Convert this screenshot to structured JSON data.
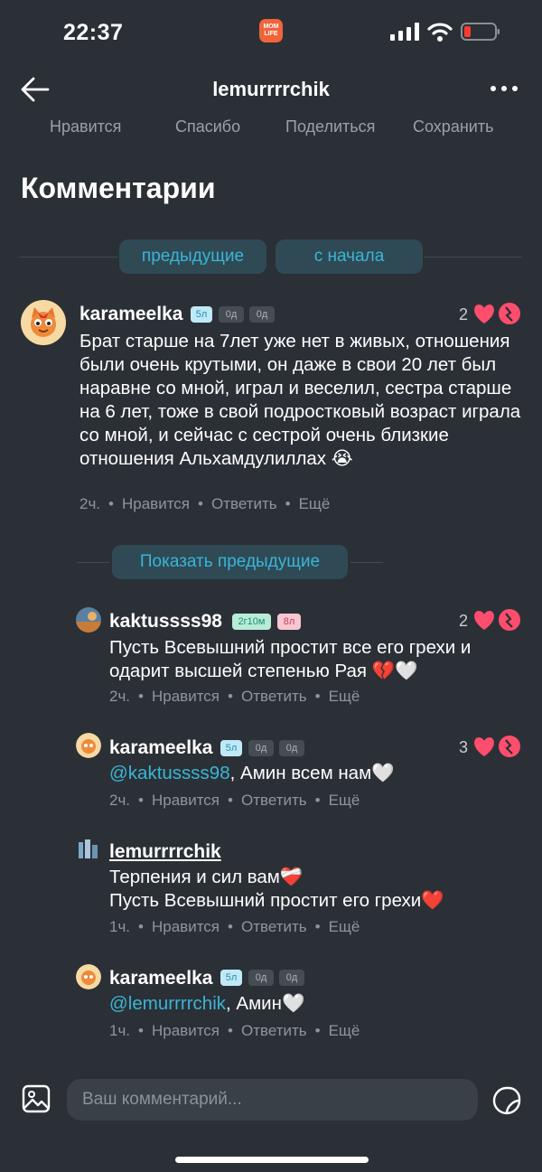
{
  "status": {
    "time": "22:37",
    "app_badge": "MOM LIFE"
  },
  "header": {
    "title": "lemurrrrchik"
  },
  "actions": [
    "Нравится",
    "Спасибо",
    "Поделиться",
    "Сохранить"
  ],
  "section_title": "Комментарии",
  "pager": {
    "prev": "предыдущие",
    "start": "с начала"
  },
  "show_previous": "Показать предыдущие",
  "meta_labels": {
    "like": "Нравится",
    "reply": "Ответить",
    "more": "Ещё"
  },
  "comments": [
    {
      "user": "karameelka",
      "badges": [
        "5л",
        "0д",
        "0д"
      ],
      "likes": "2",
      "text": "Брат старше на 7лет уже нет в живых, отношения были очень крутыми, он даже в свои 20 лет был наравне со мной, играл и веселил, сестра старше на 6 лет, тоже в свой подростковый возраст играла со мной, и сейчас с сестрой очень близкие отношения Альхамдулиллах 😭",
      "time": "2ч."
    },
    {
      "user": "kaktussss98",
      "badges": [
        "2г10м",
        "8л"
      ],
      "likes": "2",
      "text": "Пусть Всевышний простит все его грехи и одарит высшей степенью Рая 💔🤍",
      "time": "2ч."
    },
    {
      "user": "karameelka",
      "badges": [
        "5л",
        "0д",
        "0д"
      ],
      "likes": "3",
      "mention": "@kaktussss98",
      "text": ", Амин всем нам🤍",
      "time": "2ч."
    },
    {
      "user": "lemurrrrchik",
      "badges": [],
      "likes": "",
      "text_lines": [
        "Терпения и сил вам❤️‍🩹",
        "Пусть Всевышний простит его грехи❤️"
      ],
      "time": "1ч."
    },
    {
      "user": "karameelka",
      "badges": [
        "5л",
        "0д",
        "0д"
      ],
      "likes": "",
      "mention": "@lemurrrrchik",
      "text": ", Амин🤍",
      "time": "1ч."
    }
  ],
  "composer": {
    "placeholder": "Ваш комментарий..."
  },
  "colors": {
    "background": "#2b3036",
    "accent": "#39b5d6",
    "heart": "#ff4d6d"
  }
}
